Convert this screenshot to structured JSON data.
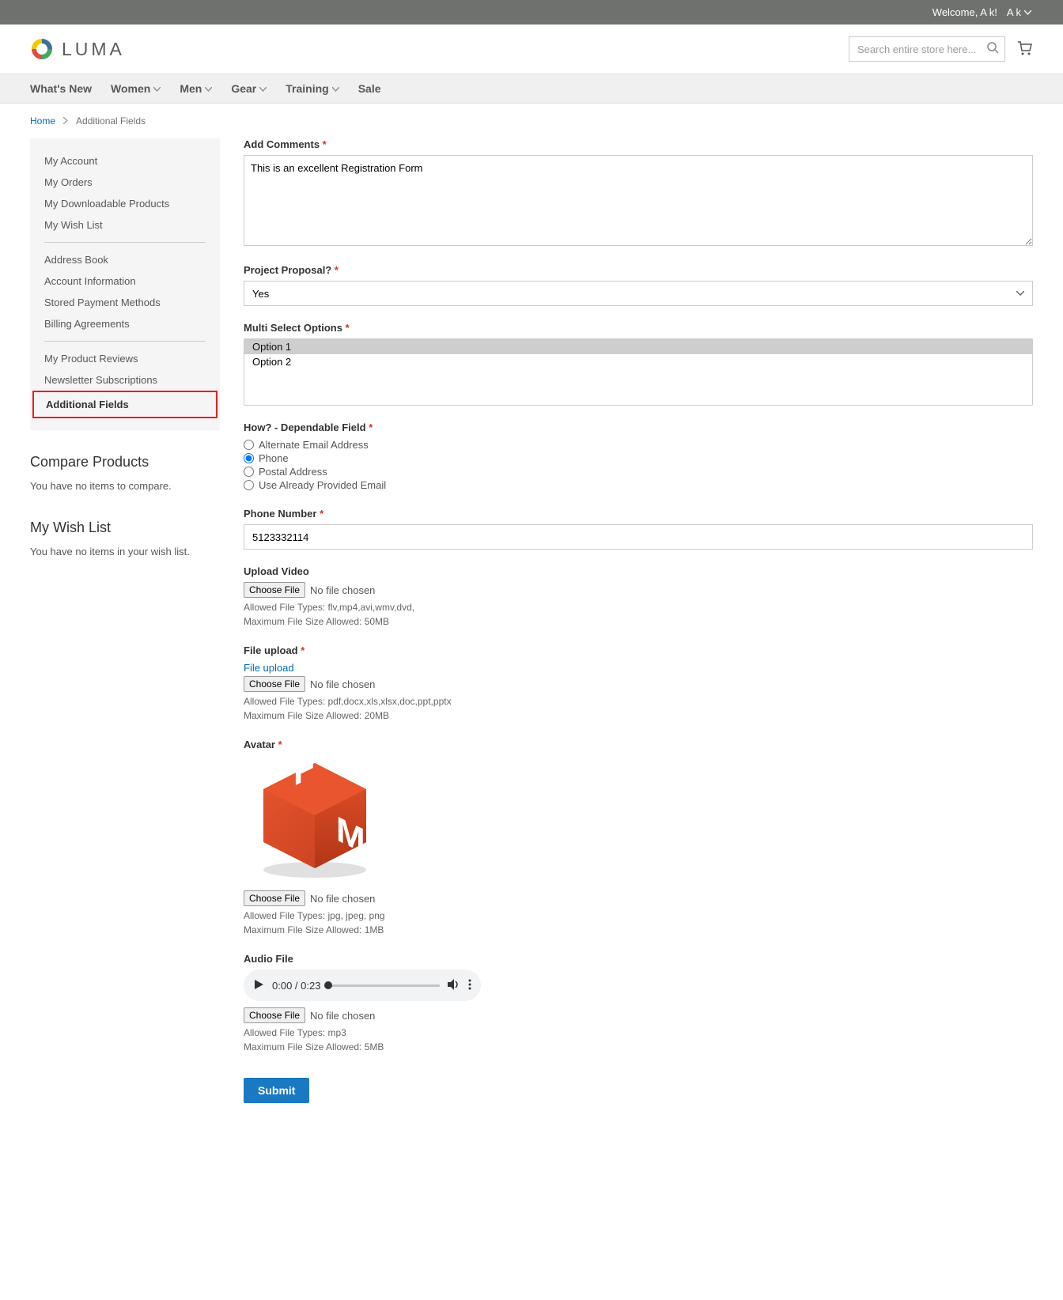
{
  "topbar": {
    "welcome": "Welcome, A k!",
    "account": "A k"
  },
  "logo_text": "LUMA",
  "search": {
    "placeholder": "Search entire store here..."
  },
  "nav": {
    "whatsnew": "What's New",
    "women": "Women",
    "men": "Men",
    "gear": "Gear",
    "training": "Training",
    "sale": "Sale"
  },
  "breadcrumbs": {
    "home": "Home",
    "current": "Additional Fields"
  },
  "sidebar": {
    "items": {
      "my_account": "My Account",
      "my_orders": "My Orders",
      "downloadable": "My Downloadable Products",
      "wishlist": "My Wish List",
      "address_book": "Address Book",
      "account_info": "Account Information",
      "payment": "Stored Payment Methods",
      "billing": "Billing Agreements",
      "reviews": "My Product Reviews",
      "newsletter": "Newsletter Subscriptions",
      "additional": "Additional Fields"
    },
    "compare": {
      "title": "Compare Products",
      "empty": "You have no items to compare."
    },
    "wishlist": {
      "title": "My Wish List",
      "empty": "You have no items in your wish list."
    }
  },
  "form": {
    "comments": {
      "label": "Add Comments",
      "value": "This is an excellent Registration Form"
    },
    "proposal": {
      "label": "Project Proposal?",
      "selected": "Yes"
    },
    "multi": {
      "label": "Multi Select Options",
      "opt1": "Option 1",
      "opt2": "Option 2"
    },
    "how": {
      "label": "How? - Dependable Field",
      "email": "Alternate Email Address",
      "phone": "Phone",
      "postal": "Postal Address",
      "provided": "Use Already Provided Email"
    },
    "phone": {
      "label": "Phone Number",
      "value": "5123332114"
    },
    "video": {
      "label": "Upload Video",
      "choose": "Choose File",
      "status": "No file chosen",
      "types": "Allowed File Types: flv,mp4,avi,wmv,dvd,",
      "size": "Maximum File Size Allowed: 50MB"
    },
    "file": {
      "label": "File upload",
      "link": "File upload",
      "choose": "Choose File",
      "status": "No file chosen",
      "types": "Allowed File Types: pdf,docx,xls,xlsx,doc,ppt,pptx",
      "size": "Maximum File Size Allowed: 20MB"
    },
    "avatar": {
      "label": "Avatar",
      "choose": "Choose File",
      "status": "No file chosen",
      "types": "Allowed File Types: jpg, jpeg, png",
      "size": "Maximum File Size Allowed: 1MB"
    },
    "audio": {
      "label": "Audio File",
      "time": "0:00 / 0:23",
      "choose": "Choose File",
      "status": "No file chosen",
      "types": "Allowed File Types: mp3",
      "size": "Maximum File Size Allowed: 5MB"
    },
    "submit": "Submit"
  }
}
